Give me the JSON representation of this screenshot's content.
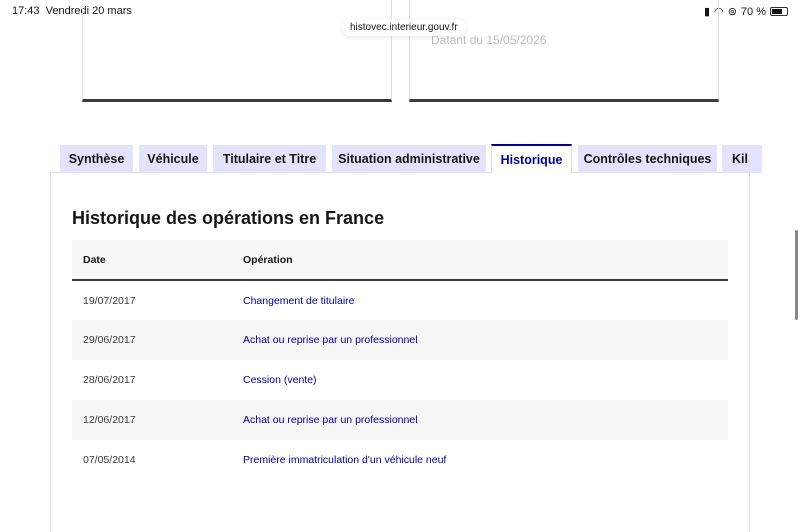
{
  "status": {
    "time": "17:43",
    "date": "Vendredi 20 mars",
    "battery": "70 %"
  },
  "url": "histovec.interieur.gouv.fr",
  "faded_text": "Datant du 15/05/2026",
  "tabs": [
    {
      "label": "Synthèse"
    },
    {
      "label": "Véhicule"
    },
    {
      "label": "Titulaire et Titre"
    },
    {
      "label": "Situation administrative"
    },
    {
      "label": "Historique"
    },
    {
      "label": "Contrôles techniques"
    },
    {
      "label": "Kil"
    }
  ],
  "section": {
    "title": "Historique des opérations en France",
    "headers": [
      "Date",
      "Opération"
    ],
    "rows": [
      {
        "date": "19/07/2017",
        "op": "Changement de titulaire"
      },
      {
        "date": "29/06/2017",
        "op": "Achat ou reprise par un professionnel"
      },
      {
        "date": "28/06/2017",
        "op": "Cession (vente)"
      },
      {
        "date": "12/06/2017",
        "op": "Achat ou reprise par un professionnel"
      },
      {
        "date": "07/05/2014",
        "op": "Première immatriculation d'un véhicule neuf"
      }
    ]
  }
}
